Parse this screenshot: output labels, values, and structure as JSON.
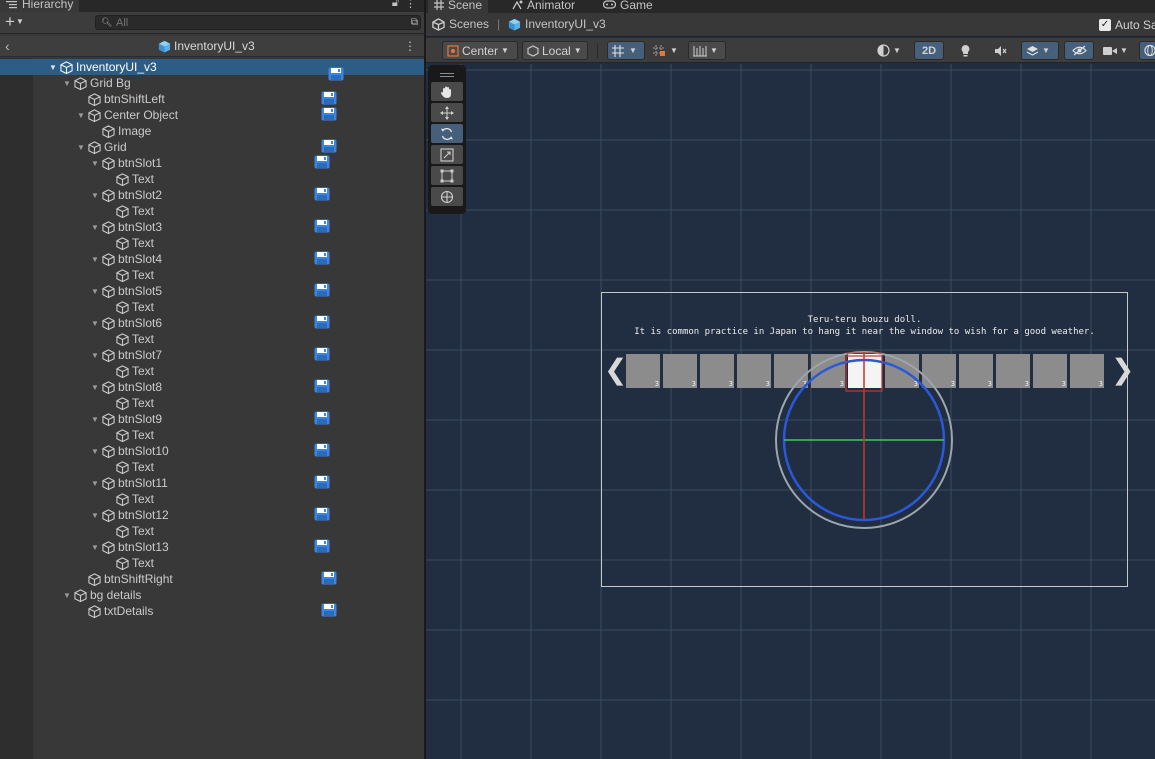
{
  "hierarchy": {
    "tab_label": "Hierarchy",
    "search_placeholder": "All",
    "prefab_title": "InventoryUI_v3",
    "rows": [
      {
        "label": "InventoryUI_v3",
        "depth": 0,
        "fold": "open",
        "selected": true,
        "save": false
      },
      {
        "label": "Grid Bg",
        "depth": 1,
        "fold": "open",
        "save": true
      },
      {
        "label": "btnShiftLeft",
        "depth": 2,
        "fold": "none",
        "save": true
      },
      {
        "label": "Center Object",
        "depth": 2,
        "fold": "open",
        "save": true
      },
      {
        "label": "Image",
        "depth": 3,
        "fold": "none",
        "save": false
      },
      {
        "label": "Grid",
        "depth": 2,
        "fold": "open",
        "save": true
      },
      {
        "label": "btnSlot1",
        "depth": 3,
        "fold": "open",
        "save": true
      },
      {
        "label": "Text",
        "depth": 4,
        "fold": "none",
        "save": false
      },
      {
        "label": "btnSlot2",
        "depth": 3,
        "fold": "open",
        "save": true
      },
      {
        "label": "Text",
        "depth": 4,
        "fold": "none",
        "save": false
      },
      {
        "label": "btnSlot3",
        "depth": 3,
        "fold": "open",
        "save": true
      },
      {
        "label": "Text",
        "depth": 4,
        "fold": "none",
        "save": false
      },
      {
        "label": "btnSlot4",
        "depth": 3,
        "fold": "open",
        "save": true
      },
      {
        "label": "Text",
        "depth": 4,
        "fold": "none",
        "save": false
      },
      {
        "label": "btnSlot5",
        "depth": 3,
        "fold": "open",
        "save": true
      },
      {
        "label": "Text",
        "depth": 4,
        "fold": "none",
        "save": false
      },
      {
        "label": "btnSlot6",
        "depth": 3,
        "fold": "open",
        "save": true
      },
      {
        "label": "Text",
        "depth": 4,
        "fold": "none",
        "save": false
      },
      {
        "label": "btnSlot7",
        "depth": 3,
        "fold": "open",
        "save": true
      },
      {
        "label": "Text",
        "depth": 4,
        "fold": "none",
        "save": false
      },
      {
        "label": "btnSlot8",
        "depth": 3,
        "fold": "open",
        "save": true
      },
      {
        "label": "Text",
        "depth": 4,
        "fold": "none",
        "save": false
      },
      {
        "label": "btnSlot9",
        "depth": 3,
        "fold": "open",
        "save": true
      },
      {
        "label": "Text",
        "depth": 4,
        "fold": "none",
        "save": false
      },
      {
        "label": "btnSlot10",
        "depth": 3,
        "fold": "open",
        "save": true
      },
      {
        "label": "Text",
        "depth": 4,
        "fold": "none",
        "save": false
      },
      {
        "label": "btnSlot11",
        "depth": 3,
        "fold": "open",
        "save": true
      },
      {
        "label": "Text",
        "depth": 4,
        "fold": "none",
        "save": false
      },
      {
        "label": "btnSlot12",
        "depth": 3,
        "fold": "open",
        "save": true
      },
      {
        "label": "Text",
        "depth": 4,
        "fold": "none",
        "save": false
      },
      {
        "label": "btnSlot13",
        "depth": 3,
        "fold": "open",
        "save": true
      },
      {
        "label": "Text",
        "depth": 4,
        "fold": "none",
        "save": false
      },
      {
        "label": "btnShiftRight",
        "depth": 2,
        "fold": "none",
        "save": true
      },
      {
        "label": "bg details",
        "depth": 1,
        "fold": "open",
        "save": false
      },
      {
        "label": "txtDetails",
        "depth": 2,
        "fold": "none",
        "save": true
      }
    ]
  },
  "top_tabs": {
    "scene": "Scene",
    "animator": "Animator",
    "game": "Game"
  },
  "breadcrumb": {
    "scenes": "Scenes",
    "prefab": "InventoryUI_v3",
    "auto_save": "Auto Save"
  },
  "scene_toolbar": {
    "pivot_mode": "Center",
    "pivot_space": "Local",
    "mode_2d": "2D"
  },
  "scene_view": {
    "details_line1": "Teru-teru bouzu doll.",
    "details_line2": "It is common practice in Japan to hang it near the window to wish for a good weather.",
    "shift_left": "❮",
    "shift_right": "❯",
    "slot_count": "3",
    "slot_count_total": 13
  },
  "colors": {
    "selection": "#2c5d87",
    "scene_bg": "#212e41",
    "save_icon": "#3d86e0",
    "prefab_icon": "#5ab0e8",
    "gizmo_blue": "#2a58d8",
    "gizmo_red": "#c0392b",
    "gizmo_green": "#3cc85a"
  }
}
